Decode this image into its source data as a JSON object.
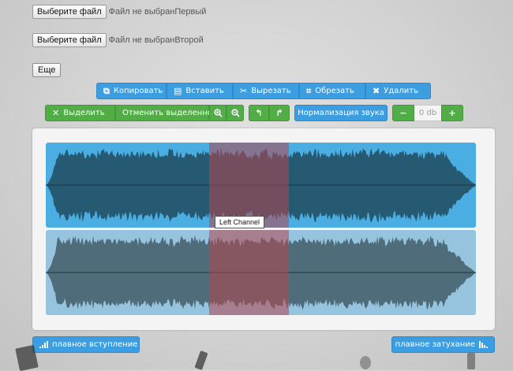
{
  "file_inputs": [
    {
      "button_label": "Выберите файл",
      "status": "Файл не выбранПервый"
    },
    {
      "button_label": "Выберите файл",
      "status": "Файл не выбранВторой"
    }
  ],
  "more_button": "Еще",
  "edit_toolbar": {
    "copy": "Копировать",
    "paste": "Вставить",
    "cut": "Вырезать",
    "trim": "Обрезать",
    "delete": "Удалить"
  },
  "select_toolbar": {
    "select": "Выделить",
    "deselect": "Отменить выделенное",
    "normalize": "Нормализация звука",
    "volume_value": "0 db",
    "volume_minus": "−",
    "volume_plus": "+"
  },
  "waveform": {
    "tooltip": "Left Channel",
    "channels": [
      {
        "color_bg": "#4aaee3",
        "color_wave": "#265a73"
      },
      {
        "color_bg": "#96c4de",
        "color_wave": "#4e6c79"
      }
    ],
    "selection_color": "#b4464e"
  },
  "fade": {
    "fade_in": "плавное вступление",
    "fade_out": "плавное затухание"
  },
  "colors": {
    "accent_blue": "#3c9ee0",
    "accent_green": "#52ad47"
  }
}
